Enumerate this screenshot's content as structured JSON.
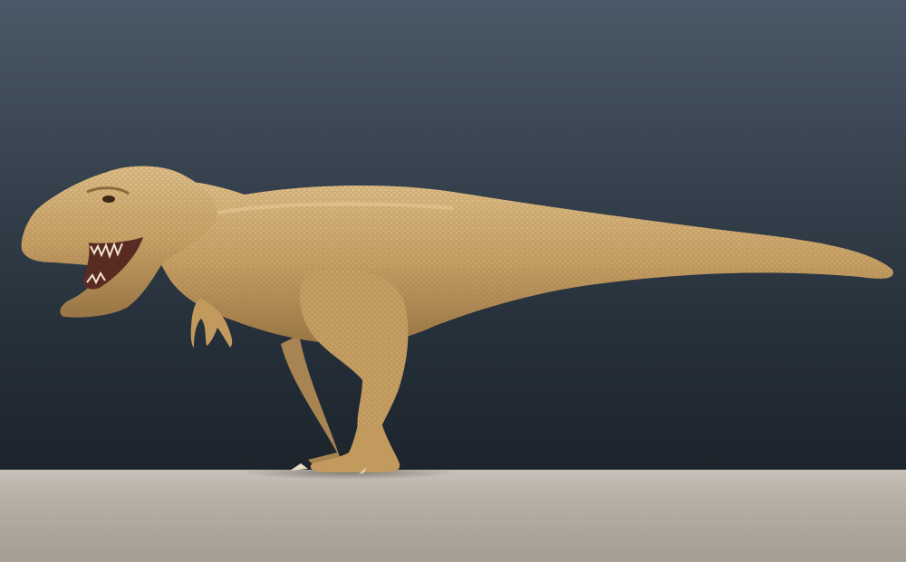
{
  "scene": {
    "subject_icon": "tyrannosaurus-icon",
    "colors": {
      "background_top": "#4b5867",
      "background_bottom": "#1c242c",
      "floor": "#b6aea5",
      "skin_light": "#d9b67c",
      "skin_mid": "#c39a5e",
      "skin_dark": "#8c6a3c"
    }
  }
}
